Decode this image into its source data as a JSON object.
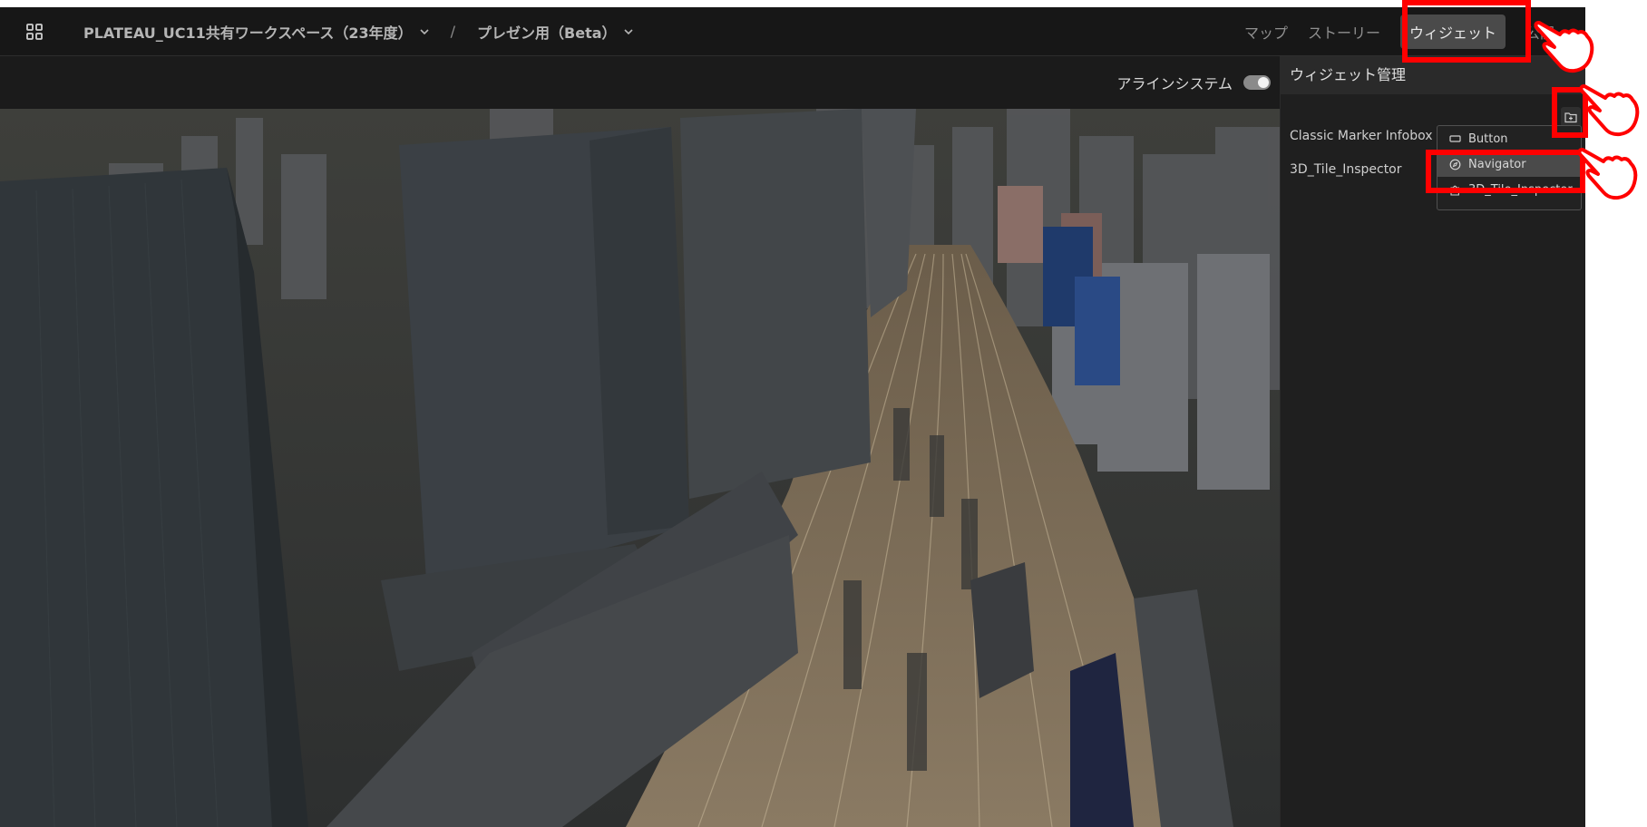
{
  "header": {
    "apps_icon": "grid-apps-icon",
    "workspace": "PLATEAU_UC11共有ワークスペース（23年度）",
    "separator": "/",
    "project": "プレゼン用（Beta）",
    "tabs": [
      "マップ",
      "ストーリー",
      "ウィジェット",
      "公開"
    ],
    "active_tab": "ウィジェット"
  },
  "toolbar": {
    "align_system_label": "アラインシステム",
    "align_system_on": false
  },
  "panel": {
    "title": "ウィジェット管理",
    "add_icon": "add-folder-icon",
    "widgets": [
      "Classic Marker Infobox",
      "3D_Tile_Inspector"
    ],
    "menu": [
      {
        "label": "Button",
        "icon": "button-rect-icon"
      },
      {
        "label": "Navigator",
        "icon": "compass-icon"
      },
      {
        "label": "3D_Tile_Inspector",
        "icon": "puzzle-icon"
      }
    ],
    "hover_item": "Navigator"
  },
  "viewport": {
    "description_icon": "3d-city-scene"
  },
  "colors": {
    "annotation": "#ff0000",
    "header_bg": "#171717",
    "panel_bg": "#1f1f1f"
  }
}
